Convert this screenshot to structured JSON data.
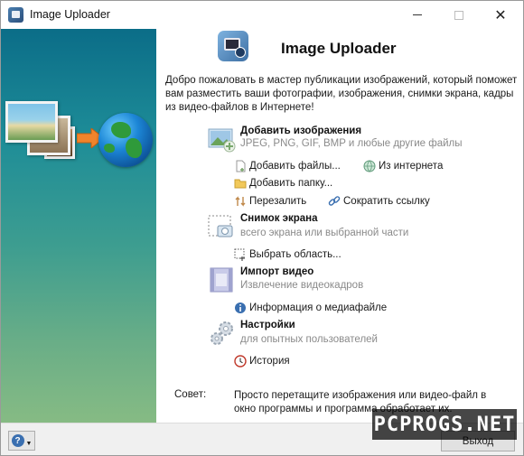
{
  "window": {
    "title": "Image Uploader"
  },
  "header": {
    "title": "Image Uploader"
  },
  "intro": "Добро пожаловать в мастер публикации изображений, который поможет вам разместить ваши фотографии, изображения, снимки экрана, кадры из видео-файлов в Интернете!",
  "add_images": {
    "title": "Добавить изображения",
    "subtitle": "JPEG, PNG, GIF, BMP и любые другие файлы",
    "add_files": "Добавить файлы...",
    "from_internet": "Из интернета",
    "add_folder": "Добавить папку...",
    "reupload": "Перезалить",
    "shorten_link": "Сократить ссылку"
  },
  "screenshot": {
    "title": "Снимок экрана",
    "subtitle": "всего экрана или выбранной части",
    "select_area": "Выбрать область..."
  },
  "video": {
    "title": "Импорт видео",
    "subtitle": "Извлечение видеокадров",
    "media_info": "Информация о медиафайле"
  },
  "settings": {
    "title": "Настройки",
    "subtitle": "для опытных пользователей",
    "history": "История"
  },
  "tip": {
    "label": "Совет:",
    "text": "Просто перетащите изображения или видео-файл в окно программы и программа обработает их."
  },
  "footer": {
    "exit_label": "Выход",
    "help_glyph": "?"
  },
  "watermark": "PCPROGS.NET",
  "colors": {
    "accent": "#1e8d98",
    "link_icon": "#3a6fb0"
  }
}
